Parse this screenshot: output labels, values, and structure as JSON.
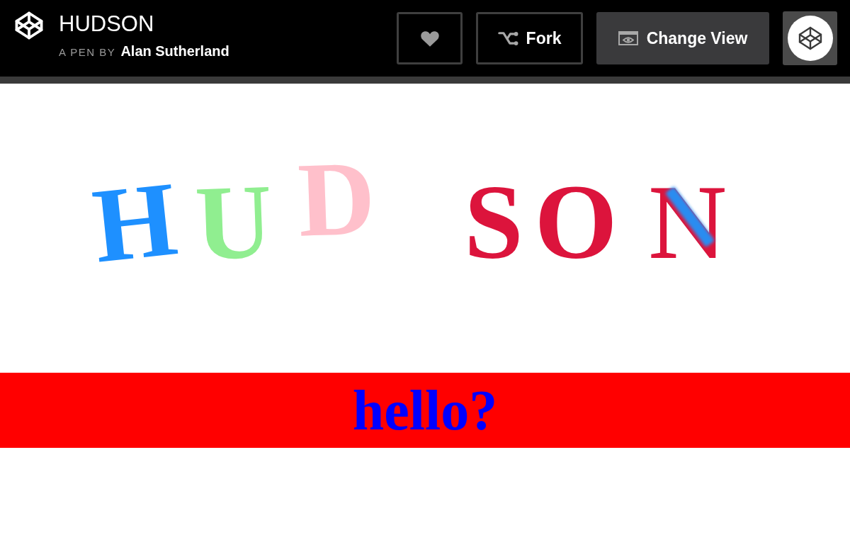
{
  "header": {
    "title": "HUDSON",
    "byline_prefix": "A PEN BY",
    "author": "Alan Sutherland",
    "buttons": [
      {
        "kind": "heart"
      },
      {
        "kind": "fork",
        "label": "Fork"
      },
      {
        "kind": "view",
        "label": "Change View"
      },
      {
        "kind": "logo"
      }
    ]
  },
  "title_letters": [
    {
      "char": "H",
      "color": "#1e90ff",
      "highlighted": false
    },
    {
      "char": "U",
      "color": "#90ee90",
      "highlighted": false
    },
    {
      "char": "D",
      "color": "#ffc0cb",
      "highlighted": false
    },
    {
      "char": "S",
      "color": "#dc143c",
      "highlighted": false
    },
    {
      "char": "O",
      "color": "#dc143c",
      "highlighted": false
    },
    {
      "char": "N",
      "color": "#dc143c",
      "highlighted": true
    }
  ],
  "banner": {
    "text": "hello?"
  }
}
